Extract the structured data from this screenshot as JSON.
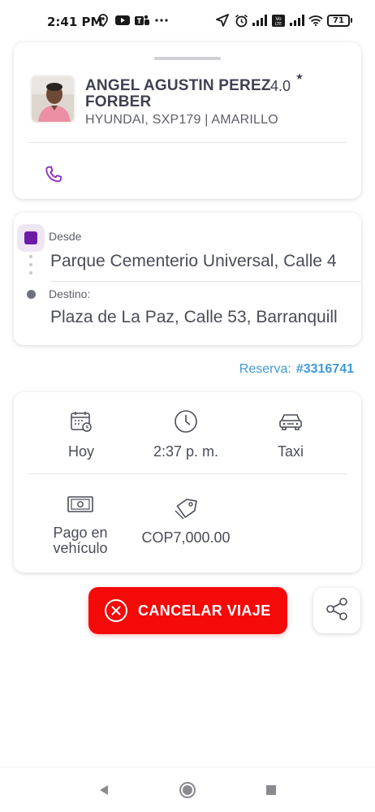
{
  "status_bar": {
    "time": "2:41 PM",
    "battery": "71",
    "left_icons": [
      "location-pin-icon",
      "youtube-icon",
      "teams-icon",
      "more-dots-icon"
    ],
    "right_icons": [
      "navigation-arrow-icon",
      "alarm-icon",
      "signal-icon",
      "volte-icon",
      "signal-icon",
      "wifi-icon",
      "battery-icon"
    ]
  },
  "driver": {
    "name": "ANGEL AGUSTIN PEREZ FORBER",
    "rating": "4.0",
    "rating_star": "★",
    "vehicle": "HYUNDAI, SXP179 | AMARILLO",
    "call_icon": "phone-icon"
  },
  "route": {
    "origin_label": "Desde",
    "origin_value": "Parque Cementerio Universal, Calle 4",
    "destination_label": "Destino:",
    "destination_value": "Plaza de La Paz, Calle 53, Barranquill"
  },
  "reservation": {
    "label": "Reserva:",
    "number": "#3316741"
  },
  "details": {
    "day": "Hoy",
    "time": "2:37 p. m.",
    "service": "Taxi",
    "payment": "Pago en vehículo",
    "price": "COP7,000.00"
  },
  "actions": {
    "cancel_label": "CANCELAR VIAJE",
    "share_icon": "share-icon"
  },
  "colors": {
    "primary_purple": "#6b1ba6",
    "cancel_red": "#f50a0a",
    "reserva_blue": "#3f9ad8"
  }
}
